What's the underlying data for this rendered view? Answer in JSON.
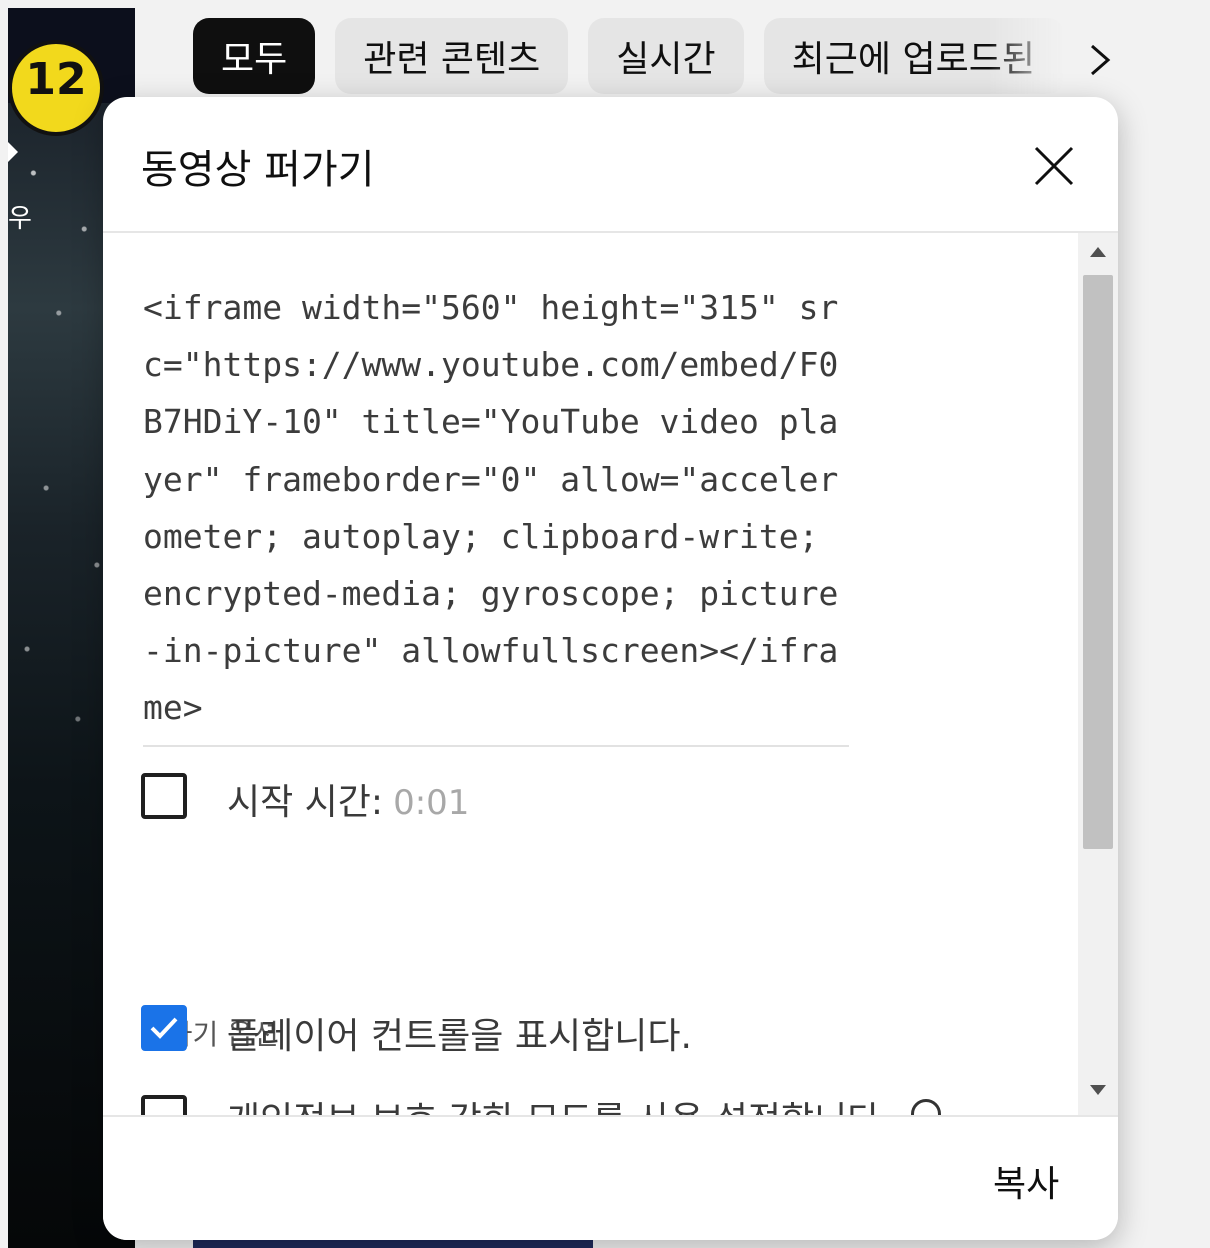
{
  "background": {
    "age_badge": "12",
    "side_text": "우"
  },
  "chips": [
    {
      "label": "모두",
      "active": true
    },
    {
      "label": "관련 콘텐츠",
      "active": false
    },
    {
      "label": "실시간",
      "active": false
    },
    {
      "label": "최근에 업로드된",
      "active": false
    }
  ],
  "dialog": {
    "title": "동영상 퍼가기",
    "embed_code": "<iframe width=\"560\" height=\"315\" src=\"https://www.youtube.com/embed/F0B7HDiY-10\" title=\"YouTube video player\" frameborder=\"0\" allow=\"accelerometer; autoplay; clipboard-write; encrypted-media; gyroscope; picture-in-picture\" allowfullscreen></iframe>",
    "start_time": {
      "label": "시작 시간:",
      "value": "0:01",
      "checked": false
    },
    "options_heading": "퍼가기 옵션",
    "options": [
      {
        "label": "플레이어 컨트롤을 표시합니다.",
        "checked": true
      },
      {
        "label": "개인정보 보호 강화 모드를 사용 설정합니다.",
        "checked": false
      }
    ],
    "copy_label": "복사"
  },
  "colors": {
    "accent": "#1a73e8",
    "chip_active_bg": "#0f0f0f",
    "chip_bg": "#e5e5e5"
  }
}
